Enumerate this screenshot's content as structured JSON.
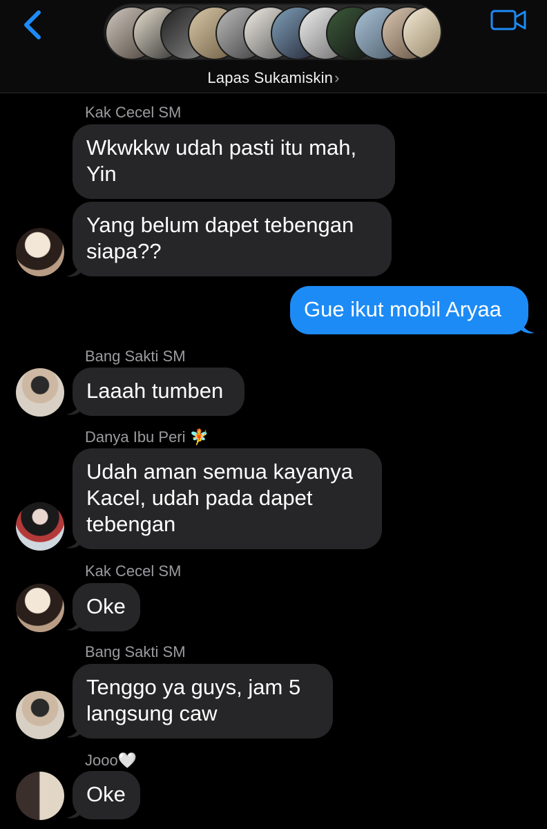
{
  "header": {
    "group_name": "Lapas Sukamiskin",
    "chevron": "›",
    "back_icon": "chevron-left-icon",
    "video_icon": "video-camera-icon",
    "accent": "#1d8bf6"
  },
  "messages": [
    {
      "sender": "Kak Cecel SM",
      "text": "Wkwkkw udah pasti itu mah,\nYin",
      "side": "left"
    },
    {
      "sender": "",
      "text": "Yang belum dapet tebengan\nsiapa??",
      "side": "left"
    },
    {
      "sender": "",
      "text": "Gue ikut mobil Aryaa",
      "side": "right"
    },
    {
      "sender": "Bang Sakti SM",
      "text": "Laaah tumben",
      "side": "left"
    },
    {
      "sender": "Danya Ibu Peri 🧚",
      "text": "Udah aman semua kayanya\nKacel, udah pada dapet\ntebengan",
      "side": "left"
    },
    {
      "sender": "Kak Cecel SM",
      "text": "Oke",
      "side": "left"
    },
    {
      "sender": "Bang Sakti SM",
      "text": "Tenggo ya guys, jam 5\nlangsung caw",
      "side": "left"
    },
    {
      "sender": "Jooo🤍",
      "text": "Oke",
      "side": "left"
    }
  ],
  "colors": {
    "incoming_bubble": "#262628",
    "outgoing_bubble": "#1d8bf6",
    "sender_name": "#9b9ba0"
  }
}
